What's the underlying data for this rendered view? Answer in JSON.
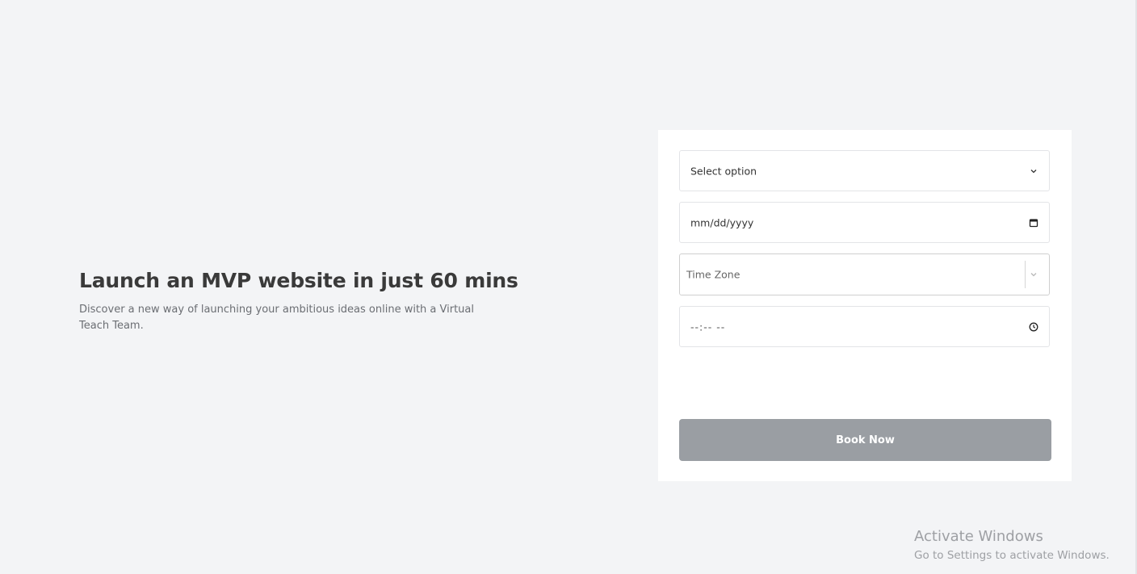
{
  "hero": {
    "title": "Launch an MVP website in just 60 mins",
    "subtitle": "Discover a new way of launching your ambitious ideas online with a Virtual Teach Team."
  },
  "form": {
    "select": {
      "value": "Select option",
      "icon": "chevron-down-icon"
    },
    "date": {
      "value": "mm/dd/yyyy",
      "icon": "calendar-icon"
    },
    "timezone": {
      "placeholder": "Time Zone",
      "icon": "chevron-down-icon"
    },
    "time": {
      "value": "--:-- --",
      "icon": "clock-icon"
    },
    "submit_label": "Book Now"
  },
  "watermark": {
    "title": "Activate Windows",
    "subtitle": "Go to Settings to activate Windows."
  },
  "colors": {
    "background": "#f3f4f6",
    "card": "#ffffff",
    "button": "#9a9ea3",
    "heading": "#3a3a3a"
  }
}
